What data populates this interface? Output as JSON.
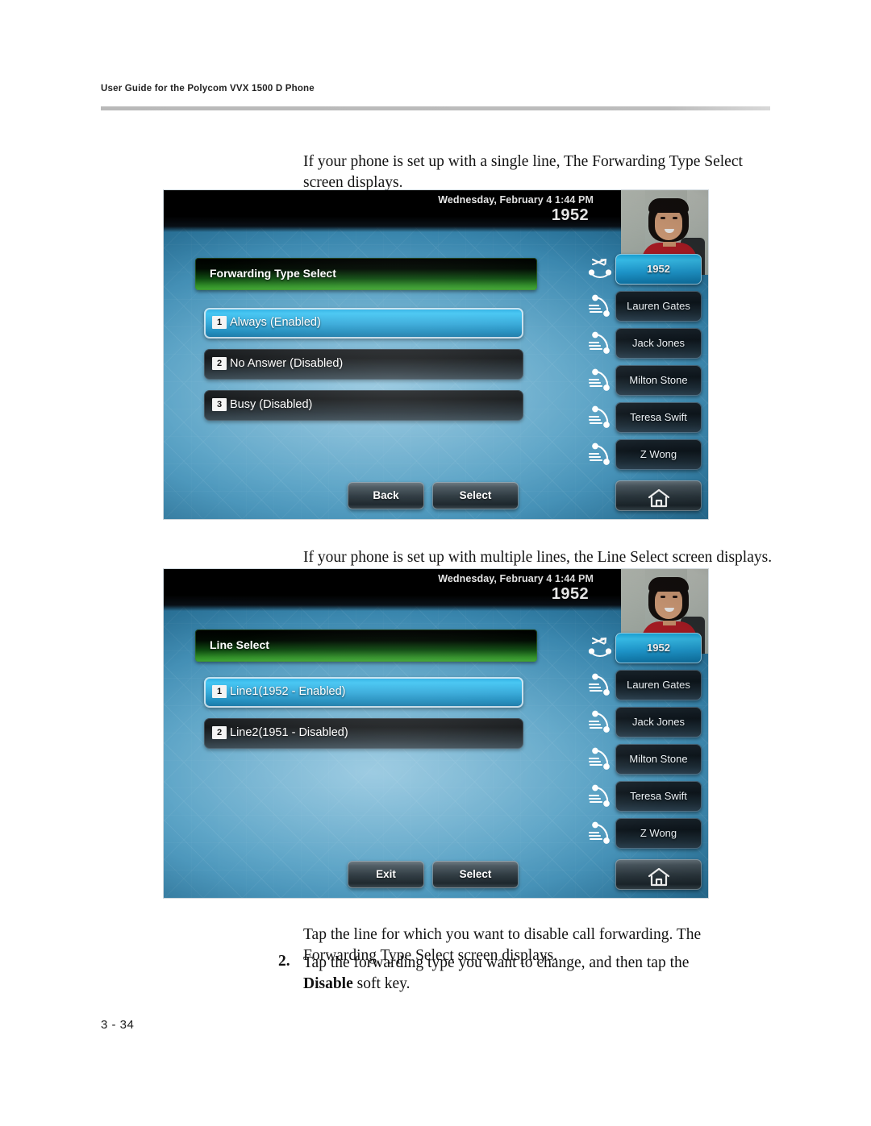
{
  "page": {
    "running_head": "User Guide for the Polycom VVX 1500 D Phone",
    "folio": "3 - 34"
  },
  "body": {
    "intro_single": "If your phone is set up with a single line, The Forwarding Type Select screen displays.",
    "intro_multi": "If your phone is set up with multiple lines, the Line Select screen displays.",
    "tap_line": "Tap the line for which you want to disable call forwarding. The Forwarding Type Select screen displays.",
    "step2_number": "2.",
    "step2_text_a": "Tap the forwarding type you want to change, and then tap the ",
    "step2_bold": "Disable",
    "step2_text_b": " soft key."
  },
  "screenshot1": {
    "status": {
      "date_time": "Wednesday, February 4  1:44 PM",
      "extension": "1952"
    },
    "banner_title": "Forwarding Type Select",
    "menu": [
      {
        "index": "1",
        "label": "Always (Enabled)",
        "selected": true
      },
      {
        "index": "2",
        "label": "No Answer (Disabled)",
        "selected": false
      },
      {
        "index": "3",
        "label": "Busy (Disabled)",
        "selected": false
      }
    ],
    "line_keys": [
      {
        "label": "1952",
        "icon": "call-forward-icon",
        "active": true
      },
      {
        "label": "Lauren Gates",
        "icon": "handset-icon",
        "active": false
      },
      {
        "label": "Jack Jones",
        "icon": "handset-icon",
        "active": false
      },
      {
        "label": "Milton Stone",
        "icon": "handset-icon",
        "active": false
      },
      {
        "label": "Teresa Swift",
        "icon": "handset-icon",
        "active": false
      },
      {
        "label": "Z Wong",
        "icon": "handset-icon",
        "active": false
      }
    ],
    "soft_keys": {
      "left": "Back",
      "right": "Select",
      "home_icon": "home-icon"
    }
  },
  "screenshot2": {
    "status": {
      "date_time": "Wednesday, February 4  1:44 PM",
      "extension": "1952"
    },
    "banner_title": "Line Select",
    "menu": [
      {
        "index": "1",
        "label": "Line1(1952 - Enabled)",
        "selected": true
      },
      {
        "index": "2",
        "label": "Line2(1951 - Disabled)",
        "selected": false
      }
    ],
    "line_keys": [
      {
        "label": "1952",
        "icon": "call-forward-icon",
        "active": true
      },
      {
        "label": "Lauren Gates",
        "icon": "handset-icon",
        "active": false
      },
      {
        "label": "Jack Jones",
        "icon": "handset-icon",
        "active": false
      },
      {
        "label": "Milton Stone",
        "icon": "handset-icon",
        "active": false
      },
      {
        "label": "Teresa Swift",
        "icon": "handset-icon",
        "active": false
      },
      {
        "label": "Z Wong",
        "icon": "handset-icon",
        "active": false
      }
    ],
    "soft_keys": {
      "left": "Exit",
      "right": "Select",
      "home_icon": "home-icon"
    }
  },
  "colors": {
    "banner_green": "#3fa630",
    "selected_blue": "#2ea6d8",
    "screen_blue": "#2e7ca5"
  }
}
